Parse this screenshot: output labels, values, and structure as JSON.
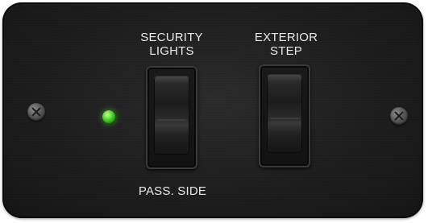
{
  "panel": {
    "controls": [
      {
        "id": "security-lights",
        "label": "SECURITY\nLIGHTS",
        "sub_label": "PASS. SIDE"
      },
      {
        "id": "exterior-step",
        "label": "EXTERIOR\nSTEP"
      }
    ],
    "indicator": {
      "color": "#5fe03a",
      "state": "on"
    },
    "colors": {
      "panel": "#1f1f1f",
      "text": "#e8e8e8"
    }
  }
}
